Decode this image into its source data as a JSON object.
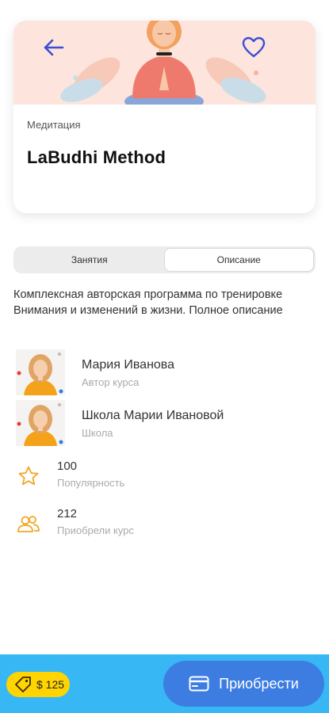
{
  "course": {
    "category": "Медитация",
    "title": "LaBudhi Method"
  },
  "tabs": [
    {
      "label": "Занятия",
      "active": false
    },
    {
      "label": "Описание",
      "active": true
    }
  ],
  "description": "Комплексная авторская программа по тренировке Внимания и изменений в жизни. Полное описание",
  "people": [
    {
      "name": "Мария Иванова",
      "role": "Автор курса"
    },
    {
      "name": "Школа Марии Ивановой",
      "role": "Школа"
    }
  ],
  "stats": [
    {
      "icon": "star-icon",
      "value": "100",
      "label": "Популярность"
    },
    {
      "icon": "users-icon",
      "value": "212",
      "label": "Приобрели курс"
    }
  ],
  "purchase": {
    "price": "$ 125",
    "button_label": "Приобрести"
  },
  "colors": {
    "accent_blue": "#3d7de2",
    "bar_blue": "#37b8f5",
    "price_yellow": "#ffd400",
    "icon_orange": "#f5a623",
    "hero_bg": "#fde4dc"
  }
}
